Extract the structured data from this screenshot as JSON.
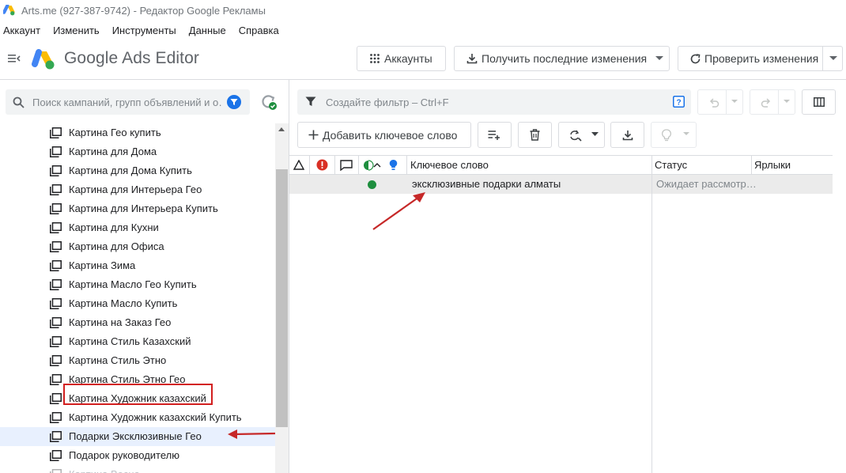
{
  "window": {
    "title": "Arts.me (927-387-9742) - Редактор Google Рекламы",
    "app_logo_icon": "google-ads-logo"
  },
  "menubar": {
    "items": [
      "Аккаунт",
      "Изменить",
      "Инструменты",
      "Данные",
      "Справка"
    ]
  },
  "header": {
    "brand": "Google Ads Editor",
    "accounts_label": "Аккаунты",
    "get_changes_label": "Получить последние изменения",
    "check_changes_label": "Проверить изменения"
  },
  "sidebar": {
    "search_placeholder": "Поиск кампаний, групп объявлений и о…",
    "items": [
      {
        "label": "Картина Гео купить"
      },
      {
        "label": "Картина для Дома"
      },
      {
        "label": "Картина для Дома Купить"
      },
      {
        "label": "Картина для Интерьера Гео"
      },
      {
        "label": "Картина для Интерьера Купить"
      },
      {
        "label": "Картина для Кухни"
      },
      {
        "label": "Картина для Офиса"
      },
      {
        "label": "Картина Зима"
      },
      {
        "label": "Картина Масло Гео Купить"
      },
      {
        "label": "Картина Масло Купить"
      },
      {
        "label": "Картина на Заказ Гео"
      },
      {
        "label": "Картина Стиль Казахский"
      },
      {
        "label": "Картина Стиль Этно"
      },
      {
        "label": "Картина Стиль Этно Гео"
      },
      {
        "label": "Картина Художник казахский"
      },
      {
        "label": "Картина Художник казахский Купить"
      },
      {
        "label": "Подарки Эксклюзивные Гео",
        "selected": true
      },
      {
        "label": "Подарок руководителю"
      },
      {
        "label": "Картина Весна"
      }
    ]
  },
  "main": {
    "filter_placeholder": "Создайте фильтр – Ctrl+F",
    "add_keyword_label": "Добавить ключевое слово",
    "columns": {
      "keyword": "Ключевое слово",
      "status": "Статус",
      "labels": "Ярлыки"
    },
    "rows": [
      {
        "keyword": "эксклюзивные подарки алматы",
        "status": "Ожидает рассмотр…",
        "labels": "",
        "status_color": "#1e8e3e"
      }
    ]
  },
  "colors": {
    "accent_blue": "#1a73e8",
    "annotation_red": "#d21f1f",
    "selection": "#e8f0fe",
    "status_green": "#1e8e3e",
    "error_red": "#d93025"
  }
}
